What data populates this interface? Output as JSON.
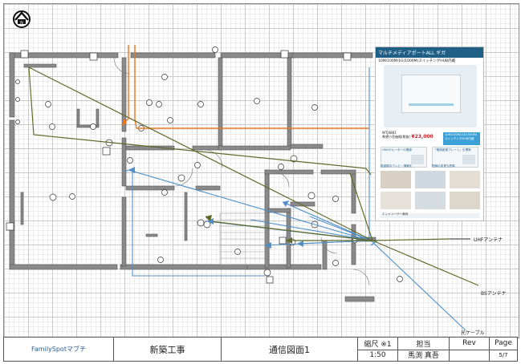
{
  "title_block": {
    "company": "FamilySpotマブチ",
    "project": "新築工事",
    "drawing_title": "通信図面1",
    "scale_label": "縮尺 ※1",
    "scale_value": "1:50",
    "staff_label": "担当",
    "staff_name": "馬渕 真吾",
    "rev_label": "Rev",
    "rev_value": "",
    "page_label": "Page",
    "page_value": "5/7"
  },
  "annotations": {
    "uhf": "UHFアンテナ",
    "bs": "BSアンテナ",
    "fiber": "光ケーブル"
  },
  "product_card": {
    "heading": "マルチメディアポートALL ギガ",
    "subheading": "10M/100M/1G(1000M)スイッチングHUB内蔵",
    "model": "WTJ4881",
    "price": "¥23,000",
    "price_note": "希望小売価格(税抜)",
    "badge": "10M/100M/1G(1000M) スイッチングHUB内蔵",
    "panels": [
      "ONUやルーターの電源",
      "「電源差連プレート」を標準",
      "各部屋のテレビ・情報を",
      "配線の変更も簡単"
    ],
    "strip": "エンドユーザー事例"
  },
  "colors": {
    "orange": "#e8781e",
    "blue": "#4f8fc9",
    "green": "#5f6b2a",
    "wall": "#8a8a8a",
    "header": "#1f5f86"
  },
  "icons": {
    "home": "home-icon"
  }
}
